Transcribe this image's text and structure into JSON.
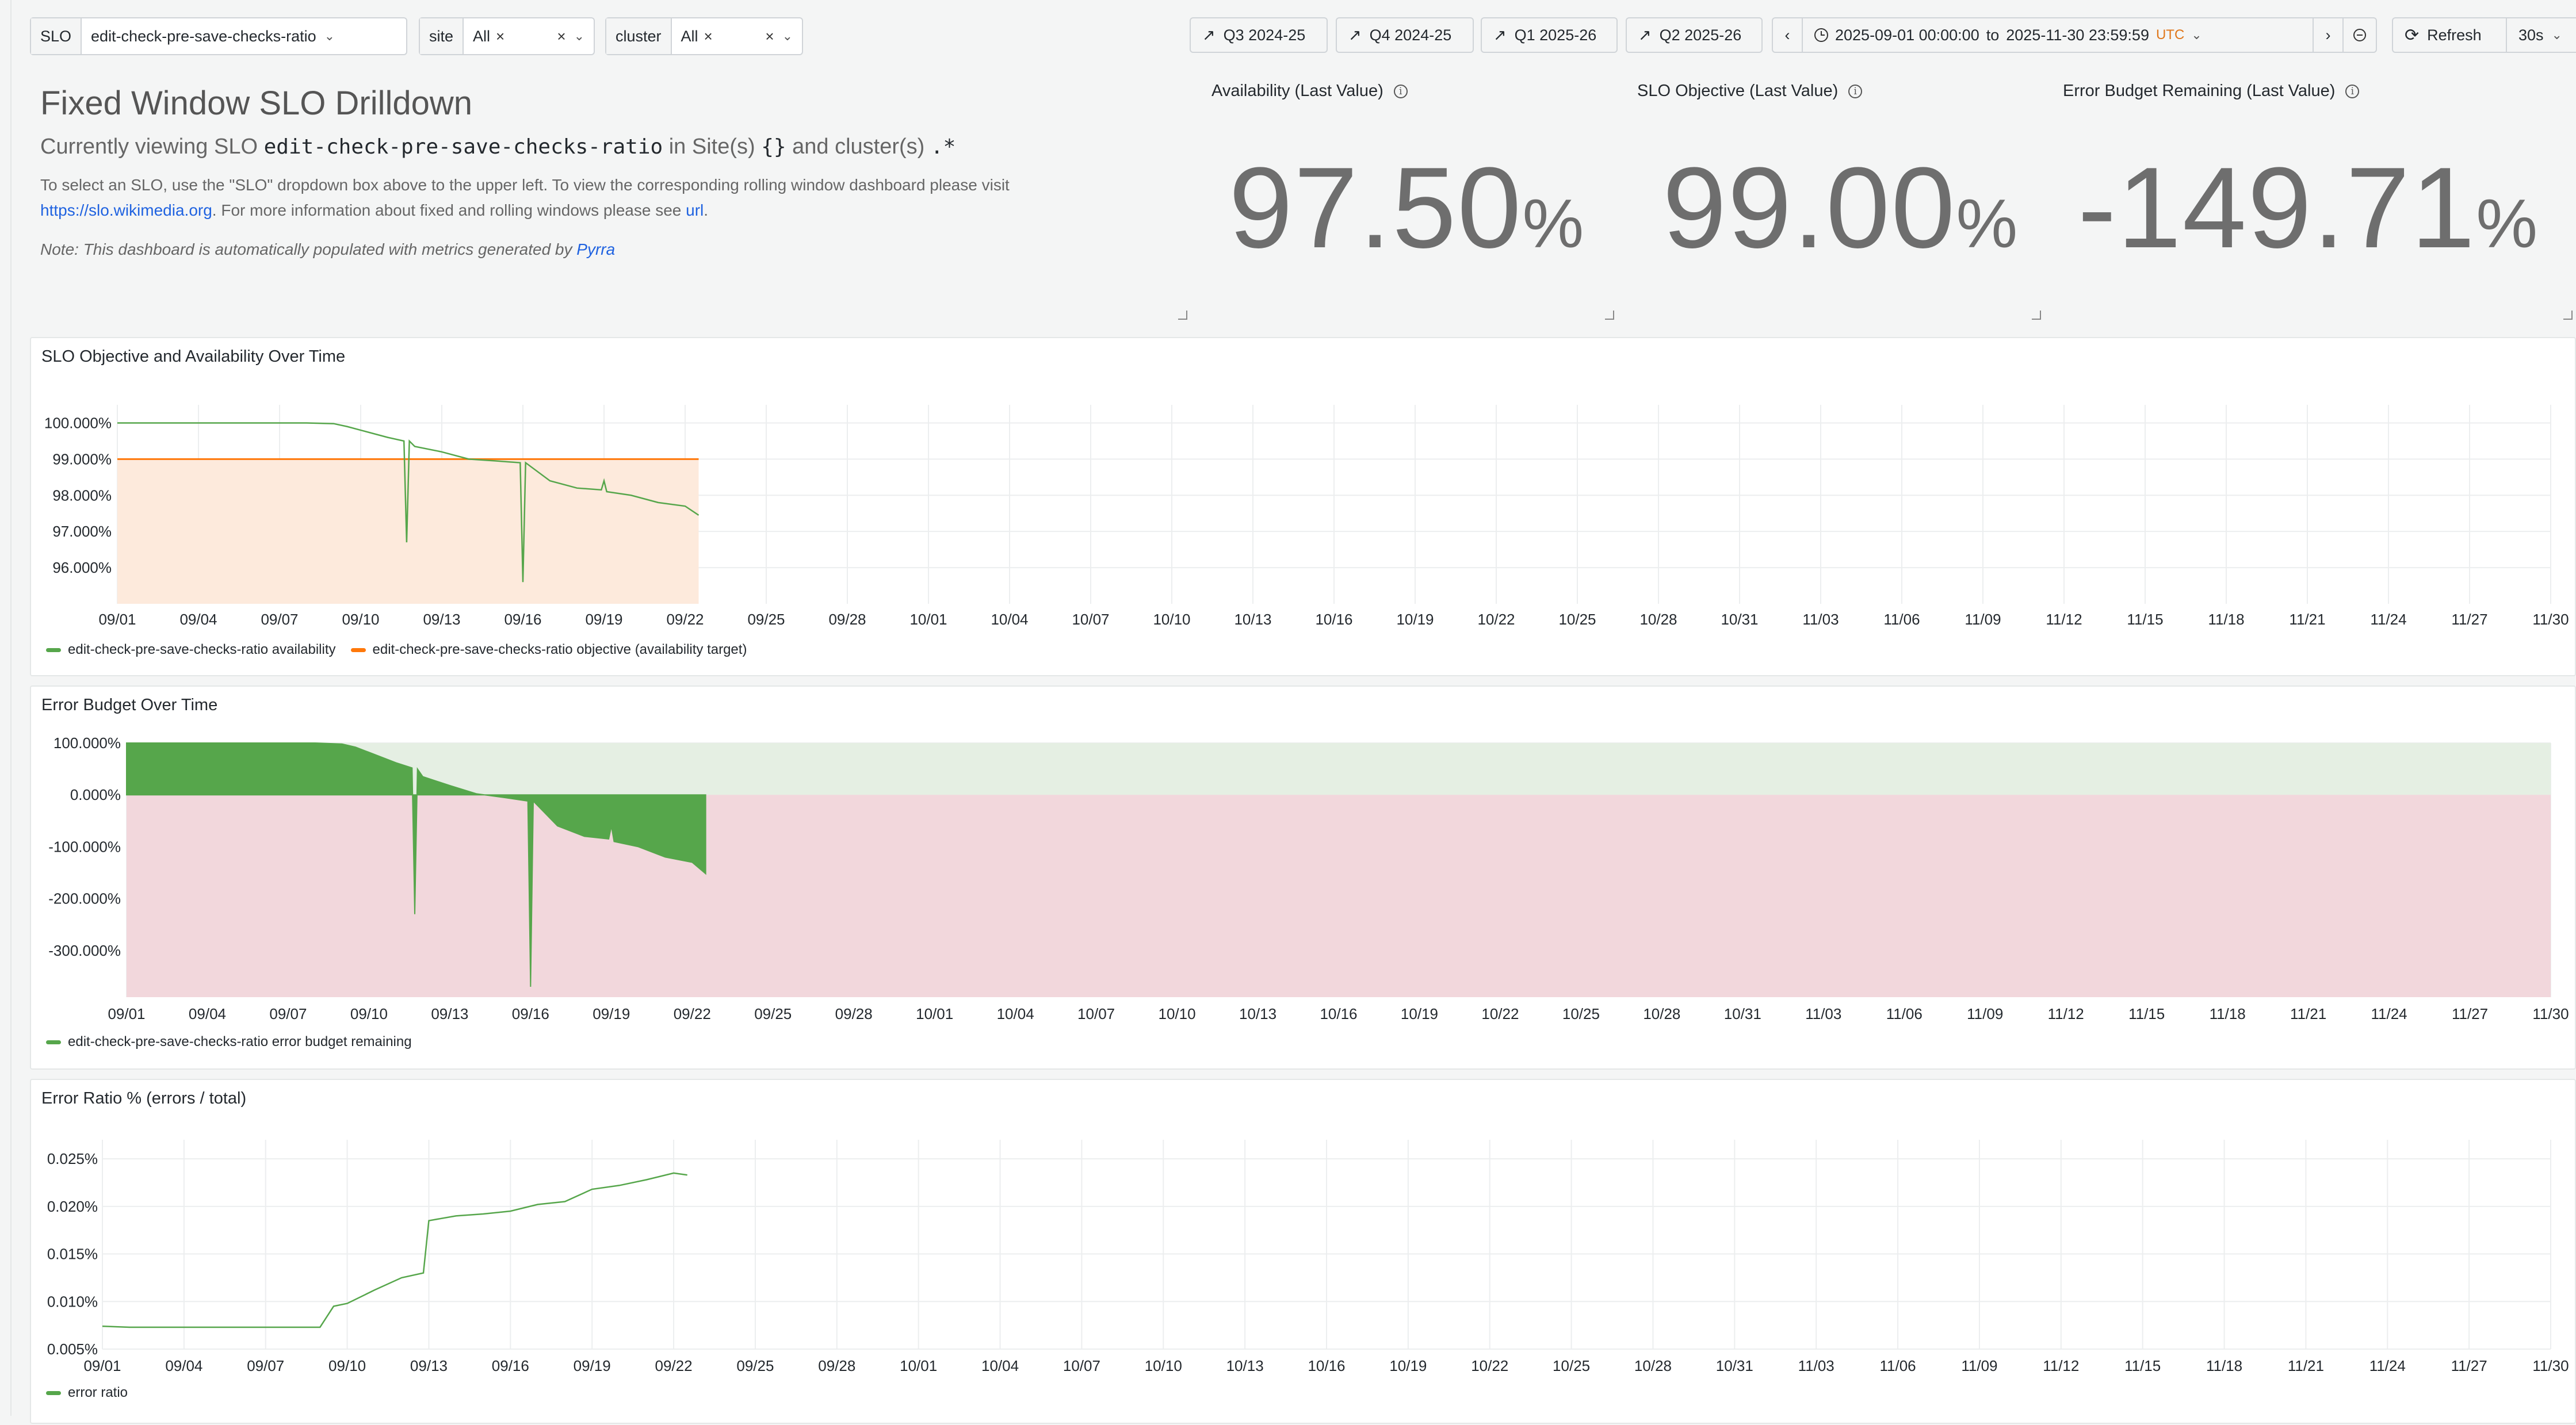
{
  "variables": {
    "slo": {
      "label": "SLO",
      "value": "edit-check-pre-save-checks-ratio"
    },
    "site": {
      "label": "site",
      "value": "All"
    },
    "cluster": {
      "label": "cluster",
      "value": "All"
    }
  },
  "toolbar": {
    "links": [
      "Q3 2024-25",
      "Q4 2024-25",
      "Q1 2025-26",
      "Q2 2025-26"
    ],
    "time_from": "2025-09-01 00:00:00",
    "time_to_word": "to",
    "time_to": "2025-11-30 23:59:59",
    "timezone": "UTC",
    "refresh_label": "Refresh",
    "refresh_interval": "30s"
  },
  "header": {
    "title": "Fixed Window SLO Drilldown",
    "viewing_prefix": "Currently viewing SLO",
    "slo_name": "edit-check-pre-save-checks-ratio",
    "in_sites": "in Site(s)",
    "site_value": "{}",
    "and_clusters": "and cluster(s)",
    "cluster_value": ".*",
    "desc_line1": "To select an SLO, use the \"SLO\" dropdown box above to the upper left. To view the corresponding rolling window dashboard please visit",
    "desc_link": "https://slo.wikimedia.org",
    "desc_line2": ". For more information about fixed and rolling windows please see",
    "desc_url": "url",
    "note_prefix": "Note: This dashboard is automatically populated with metrics generated by",
    "note_link": "Pyrra"
  },
  "stats": [
    {
      "title": "Availability (Last Value)",
      "value": "97.50",
      "unit": "%"
    },
    {
      "title": "SLO Objective (Last Value)",
      "value": "99.00",
      "unit": "%"
    },
    {
      "title": "Error Budget Remaining (Last Value)",
      "value": "-149.71",
      "unit": "%"
    }
  ],
  "x_ticks": [
    "09/01",
    "09/04",
    "09/07",
    "09/10",
    "09/13",
    "09/16",
    "09/19",
    "09/22",
    "09/25",
    "09/28",
    "10/01",
    "10/04",
    "10/07",
    "10/10",
    "10/13",
    "10/16",
    "10/19",
    "10/22",
    "10/25",
    "10/28",
    "10/31",
    "11/03",
    "11/06",
    "11/09",
    "11/12",
    "11/15",
    "11/18",
    "11/21",
    "11/24",
    "11/27",
    "11/30"
  ],
  "colors": {
    "green": "#56a64b",
    "orange": "#ff780a",
    "red_band": "#f2d7dc",
    "green_band": "#e5efe3",
    "orange_band": "#fdeadc"
  },
  "chart_data": [
    {
      "type": "line",
      "title": "SLO Objective and Availability Over Time",
      "yticks": [
        "100.000%",
        "99.000%",
        "98.000%",
        "97.000%",
        "96.000%"
      ],
      "ylim": [
        95.0,
        100.5
      ],
      "x_days": [
        0,
        1,
        2,
        3,
        4,
        5,
        6,
        7,
        8,
        8.5,
        9,
        10,
        10.6,
        10.7,
        10.8,
        11,
        12,
        13,
        14,
        14.9,
        15,
        15.1,
        16,
        17,
        17.9,
        18,
        18.1,
        19,
        20,
        21,
        21.5
      ],
      "series": [
        {
          "name": "edit-check-pre-save-checks-ratio availability",
          "values": [
            100,
            100,
            100,
            100,
            100,
            100,
            100,
            100,
            99.98,
            99.9,
            99.8,
            99.6,
            99.5,
            96.7,
            99.5,
            99.35,
            99.2,
            99.0,
            98.95,
            98.9,
            95.6,
            98.9,
            98.4,
            98.2,
            98.15,
            98.4,
            98.1,
            98.0,
            97.8,
            97.7,
            97.45
          ]
        },
        {
          "name": "edit-check-pre-save-checks-ratio objective (availability target)",
          "values": [
            99,
            99,
            99,
            99,
            99,
            99,
            99,
            99,
            99,
            99,
            99,
            99,
            99,
            99,
            99,
            99,
            99,
            99,
            99,
            99,
            99,
            99,
            99,
            99,
            99,
            99,
            99,
            99,
            99,
            99,
            99
          ]
        }
      ]
    },
    {
      "type": "area",
      "title": "Error Budget Over Time",
      "yticks": [
        "100.000%",
        "0.000%",
        "-100.000%",
        "-200.000%",
        "-300.000%"
      ],
      "ylim": [
        -390,
        100
      ],
      "x_days": [
        0,
        1,
        2,
        3,
        4,
        5,
        6,
        7,
        8,
        8.5,
        9,
        10,
        10.6,
        10.7,
        10.8,
        11,
        12,
        13,
        14,
        14.9,
        15,
        15.1,
        16,
        17,
        17.9,
        18,
        18.1,
        19,
        20,
        21,
        21.5
      ],
      "series": [
        {
          "name": "edit-check-pre-save-checks-ratio error budget remaining",
          "values": [
            100,
            100,
            100,
            100,
            100,
            100,
            100,
            100,
            98,
            92,
            82,
            62,
            52,
            -230,
            50,
            35,
            18,
            2,
            -5,
            -12,
            -370,
            -12,
            -60,
            -80,
            -85,
            -60,
            -90,
            -100,
            -120,
            -130,
            -152
          ]
        }
      ]
    },
    {
      "type": "line",
      "title": "Error Ratio % (errors / total)",
      "yticks": [
        "0.025%",
        "0.020%",
        "0.015%",
        "0.010%",
        "0.005%"
      ],
      "ylim": [
        0.005,
        0.027
      ],
      "x_days": [
        0,
        1,
        2,
        3,
        4,
        5,
        6,
        7,
        8,
        8.5,
        9,
        10,
        11,
        11.8,
        12,
        13,
        14,
        15,
        16,
        17,
        18,
        19,
        20,
        21,
        21.5
      ],
      "series": [
        {
          "name": "error ratio",
          "values": [
            0.0074,
            0.0073,
            0.0073,
            0.0073,
            0.0073,
            0.0073,
            0.0073,
            0.0073,
            0.0073,
            0.0095,
            0.0098,
            0.0112,
            0.0125,
            0.013,
            0.0185,
            0.019,
            0.0192,
            0.0195,
            0.0202,
            0.0205,
            0.0218,
            0.0222,
            0.0228,
            0.0235,
            0.0233
          ]
        }
      ]
    }
  ]
}
